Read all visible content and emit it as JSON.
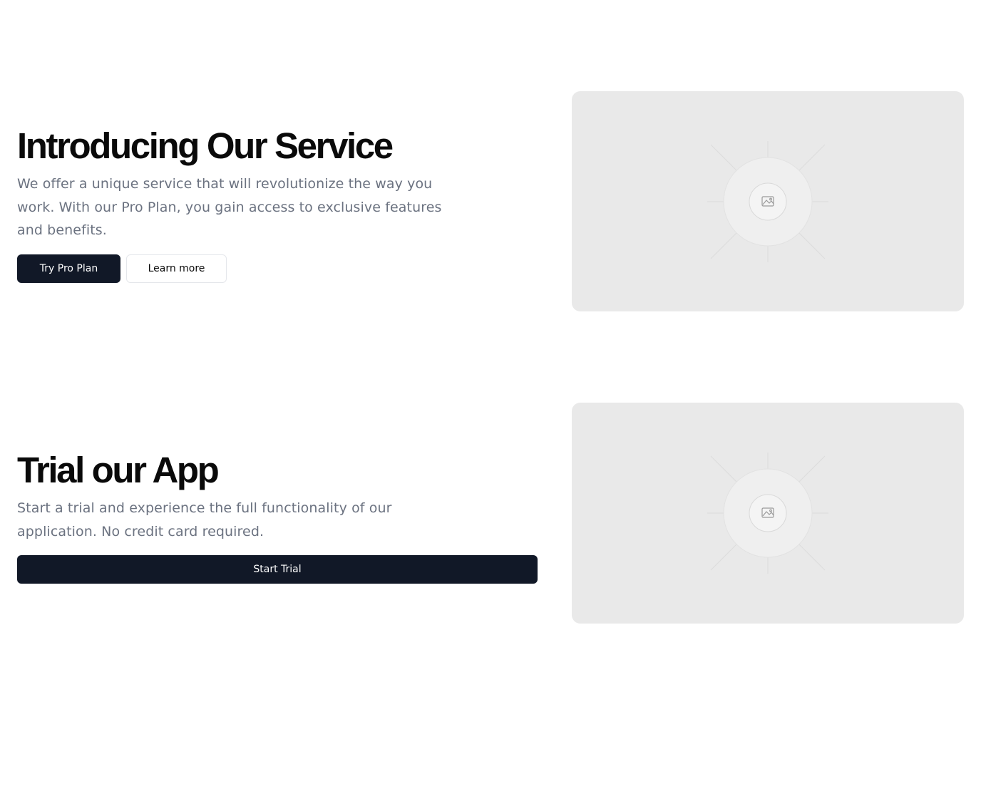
{
  "sections": [
    {
      "headline": "Introducing Our Service",
      "description_lines": [
        "We offer a unique service that will revolutionize the way you",
        "work. With our Pro Plan, you gain access to exclusive features",
        "and benefits."
      ],
      "primary_button": "Try Pro Plan",
      "secondary_button": "Learn more",
      "image_icon": "image-placeholder-icon"
    },
    {
      "headline": "Trial our App",
      "description_lines": [
        "Start a trial and experience the full functionality of our",
        "application. No credit card required."
      ],
      "primary_button": "Start Trial",
      "image_icon": "image-placeholder-icon"
    }
  ],
  "colors": {
    "primary": "#111827",
    "muted_text": "#6b7280",
    "placeholder_bg": "#e9e9e9"
  }
}
